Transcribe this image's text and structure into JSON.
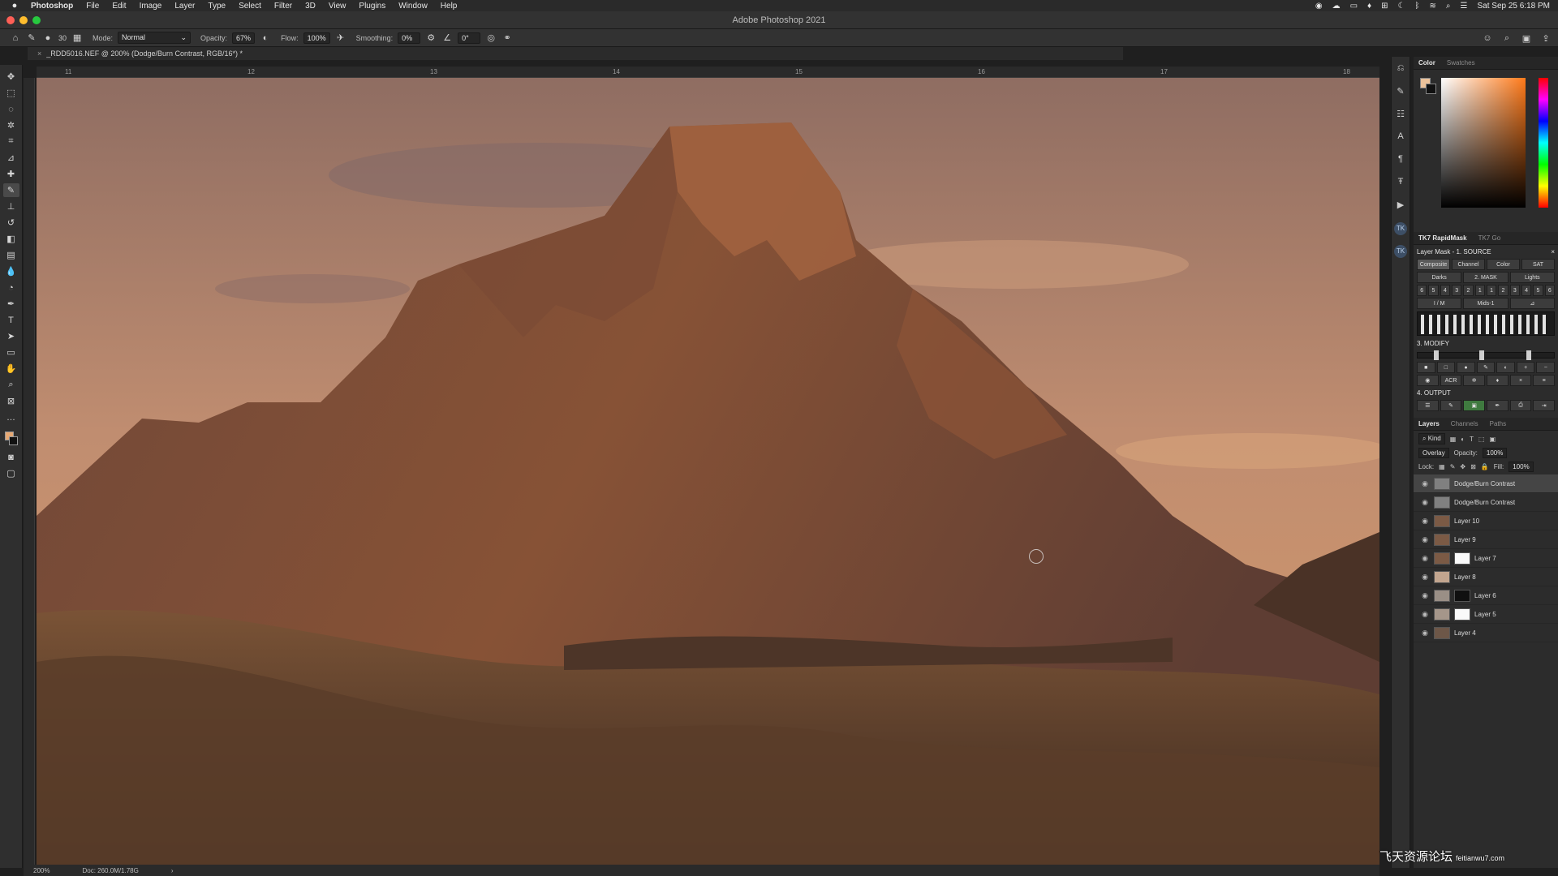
{
  "menubar": {
    "app": "Photoshop",
    "items": [
      "File",
      "Edit",
      "Image",
      "Layer",
      "Type",
      "Select",
      "Filter",
      "3D",
      "View",
      "Plugins",
      "Window",
      "Help"
    ],
    "clock": "Sat Sep 25  6:18 PM"
  },
  "window": {
    "title": "Adobe Photoshop 2021"
  },
  "options": {
    "brush_size": "30",
    "mode_label": "Mode:",
    "mode_value": "Normal",
    "opacity_label": "Opacity:",
    "opacity_value": "67%",
    "flow_label": "Flow:",
    "flow_value": "100%",
    "smoothing_label": "Smoothing:",
    "smoothing_value": "0%",
    "angle_value": "0°"
  },
  "document": {
    "tab_title": "_RDD5016.NEF @ 200% (Dodge/Burn Contrast, RGB/16*) *",
    "zoom": "200%",
    "doc_info": "Doc: 260.0M/1.78G"
  },
  "ruler": {
    "ticks": [
      "11",
      "12",
      "13",
      "14",
      "15",
      "16",
      "17",
      "18"
    ]
  },
  "panels": {
    "color_tabs": [
      "Color",
      "Swatches"
    ],
    "tk7_tabs": [
      "TK7 RapidMask",
      "TK7 Go"
    ],
    "layers_tabs": [
      "Layers",
      "Channels",
      "Paths"
    ]
  },
  "tk7": {
    "section_source": "Layer Mask - 1. SOURCE",
    "source_buttons": [
      "Composite",
      "Channel",
      "Color",
      "SAT"
    ],
    "section_mask": "2. MASK",
    "mask_darks": "Darks",
    "mask_lights": "Lights",
    "mask_numbers": [
      "6",
      "5",
      "4",
      "3",
      "2",
      "1",
      "1",
      "2",
      "3",
      "4",
      "5",
      "6"
    ],
    "mids_label": "Mids-1",
    "im_label": "I / M",
    "section_modify": "3. MODIFY",
    "acr_label": "ACR",
    "section_output": "4. OUTPUT"
  },
  "layers": {
    "filter_kind": "Kind",
    "blend_mode": "Overlay",
    "opacity_label": "Opacity:",
    "opacity_value": "100%",
    "lock_label": "Lock:",
    "fill_label": "Fill:",
    "fill_value": "100%",
    "items": [
      {
        "name": "Dodge/Burn Contrast",
        "selected": true
      },
      {
        "name": "Dodge/Burn Contrast",
        "selected": false
      },
      {
        "name": "Layer 10",
        "selected": false
      },
      {
        "name": "Layer 9",
        "selected": false
      },
      {
        "name": "Layer 7",
        "selected": false
      },
      {
        "name": "Layer 8",
        "selected": false
      },
      {
        "name": "Layer 6",
        "selected": false
      },
      {
        "name": "Layer 5",
        "selected": false
      },
      {
        "name": "Layer 4",
        "selected": false
      }
    ]
  },
  "watermark": {
    "text": "飞天资源论坛",
    "url": "feitianwu7.com"
  }
}
